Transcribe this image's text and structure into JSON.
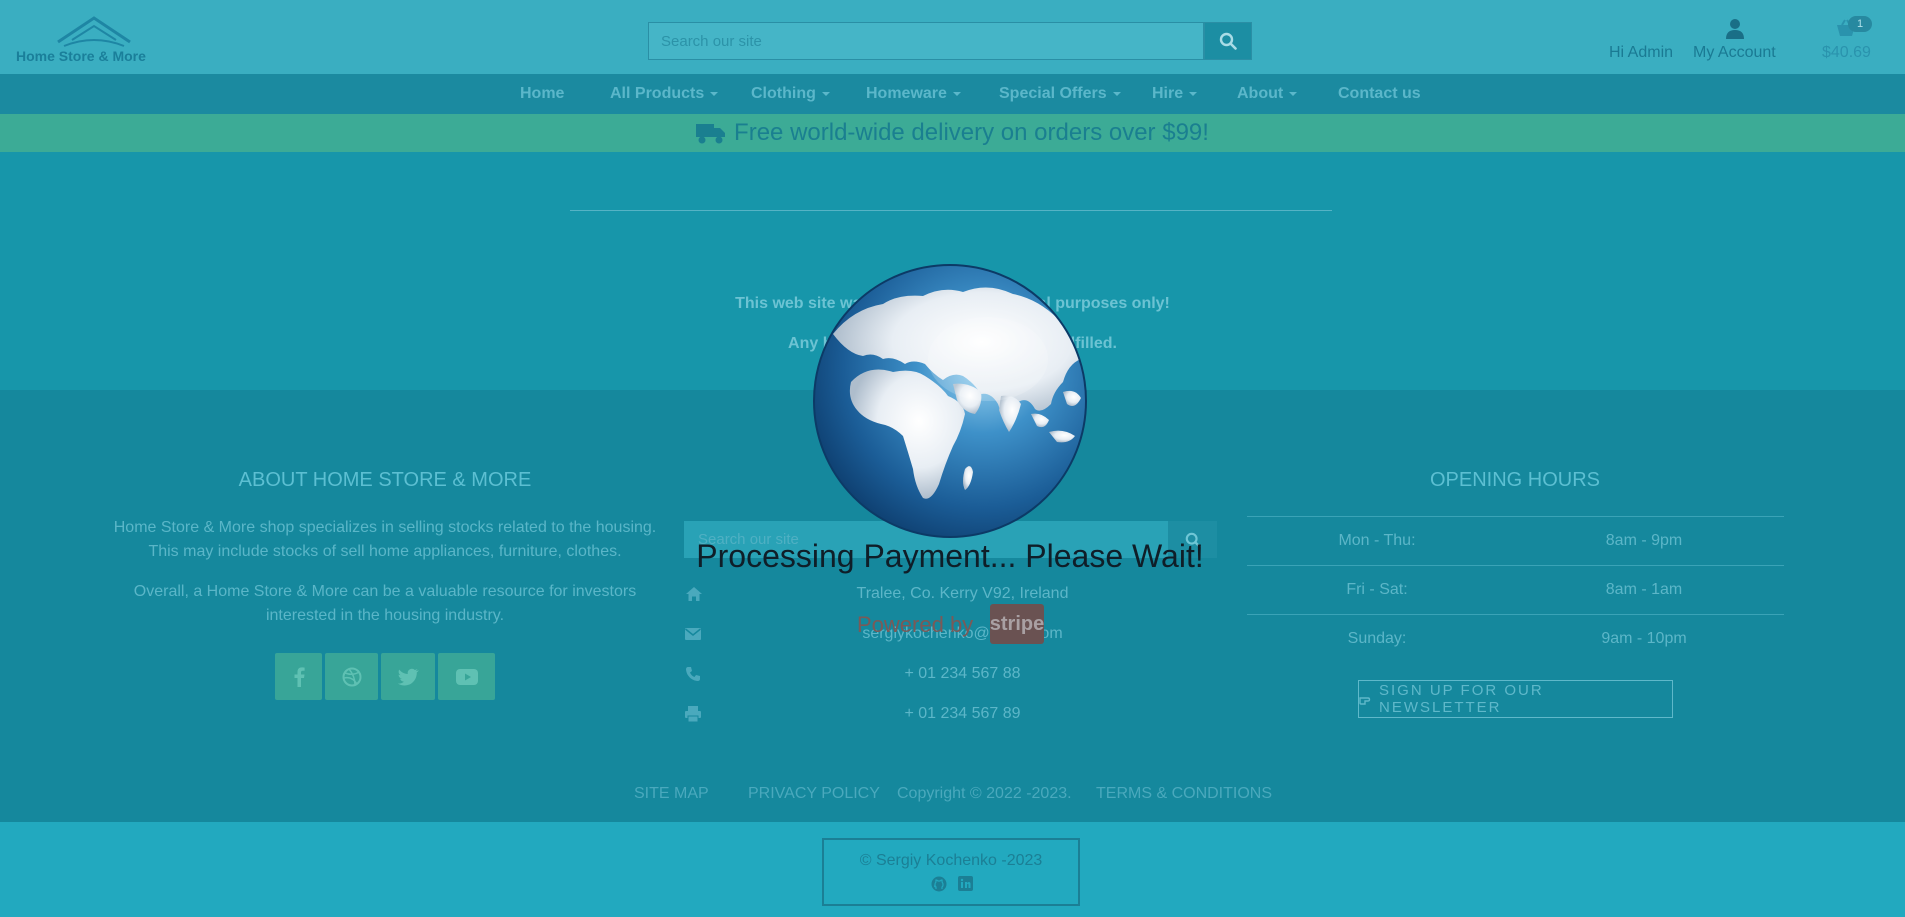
{
  "header": {
    "logo_text": "Home Store & More",
    "search_placeholder": "Search our site",
    "greeting": "Hi Admin",
    "account_label": "My Account",
    "cart_count": "1",
    "cart_total": "$40.69"
  },
  "nav": {
    "items": [
      {
        "label": "Home"
      },
      {
        "label": "All Products"
      },
      {
        "label": "Clothing"
      },
      {
        "label": "Homeware"
      },
      {
        "label": "Special Offers"
      },
      {
        "label": "Hire"
      },
      {
        "label": "About"
      },
      {
        "label": "Contact us"
      }
    ]
  },
  "banner": {
    "text": "Free world-wide delivery on orders over $99!",
    "icon": "truck-icon"
  },
  "notice": {
    "line1": "This web site was created for educational purposes only!",
    "line2": "Any bookings or orders will not be fulfilled."
  },
  "footer": {
    "about": {
      "title": "ABOUT HOME STORE & MORE",
      "para1": "Home Store & More shop specializes in selling stocks related to the housing. This may include stocks of sell home appliances, furniture, clothes.",
      "para2": "Overall, a Home Store & More can be a valuable resource for investors interested in the housing industry.",
      "social": [
        {
          "name": "facebook-icon"
        },
        {
          "name": "dribbble-icon"
        },
        {
          "name": "twitter-icon"
        },
        {
          "name": "youtube-icon"
        }
      ]
    },
    "contact": {
      "search_placeholder": "Search our site",
      "address": "Tralee, Co. Kerry V92, Ireland",
      "email": "sergiykochenko@gmail.com",
      "phone": "+ 01 234 567 88",
      "fax": "+ 01 234 567 89"
    },
    "hours": {
      "title": "OPENING HOURS",
      "rows": [
        {
          "day": "Mon - Thu:",
          "time": "8am - 9pm"
        },
        {
          "day": "Fri - Sat:",
          "time": "8am - 1am"
        },
        {
          "day": "Sunday:",
          "time": "9am - 10pm"
        }
      ],
      "newsletter_label": "SIGN UP FOR OUR NEWSLETTER"
    },
    "legal": {
      "sitemap": "SITE MAP",
      "privacy": "PRIVACY POLICY",
      "copyright": "Copyright © 2022 -2023.",
      "terms": "TERMS & CONDITIONS"
    },
    "credit": "© Sergiy Kochenko -2023"
  },
  "overlay": {
    "processing_text": "Processing Payment... Please Wait!",
    "powered_by": "Powered by",
    "stripe_label": "stripe"
  },
  "colors": {
    "header_bg": "#3aaec1",
    "nav_bg": "#1b8aa0",
    "banner_bg": "#3cab96",
    "page_bg": "#1796aa",
    "footer_bg": "#15889d"
  }
}
